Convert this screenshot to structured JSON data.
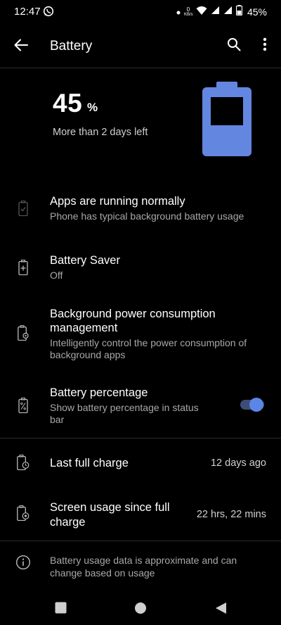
{
  "status_bar": {
    "time": "12:47",
    "net_speed_value": "0",
    "net_speed_unit": "KB/s",
    "battery_percent": "45%"
  },
  "app_bar": {
    "title": "Battery"
  },
  "battery": {
    "level": "45",
    "unit": "%",
    "time_left": "More than 2 days left",
    "fill_fraction": 0.45,
    "accent_color": "#6386e0"
  },
  "rows": {
    "apps_status": {
      "title": "Apps are running normally",
      "subtitle": "Phone has typical background battery usage"
    },
    "battery_saver": {
      "title": "Battery Saver",
      "subtitle": "Off"
    },
    "background_power": {
      "title_line1": "Background power consumption",
      "title_line2": "management",
      "subtitle_line1": "Intelligently control the power consumption of",
      "subtitle_line2": "background apps"
    },
    "battery_percentage": {
      "title": "Battery percentage",
      "subtitle_line1": "Show battery percentage in status",
      "subtitle_line2": "bar",
      "toggle_on": true
    },
    "last_full_charge": {
      "title": "Last full charge",
      "value": "12 days ago"
    },
    "screen_usage": {
      "title_line1": "Screen usage since full",
      "title_line2": "charge",
      "value": "22 hrs, 22 mins"
    }
  },
  "info": {
    "line1": "Battery usage data is approximate and can",
    "line2": "change based on usage"
  },
  "icons": {
    "back": "arrow-back",
    "search": "search",
    "more": "more-vert",
    "nav_recents": "square",
    "nav_home": "circle",
    "nav_back": "triangle"
  }
}
